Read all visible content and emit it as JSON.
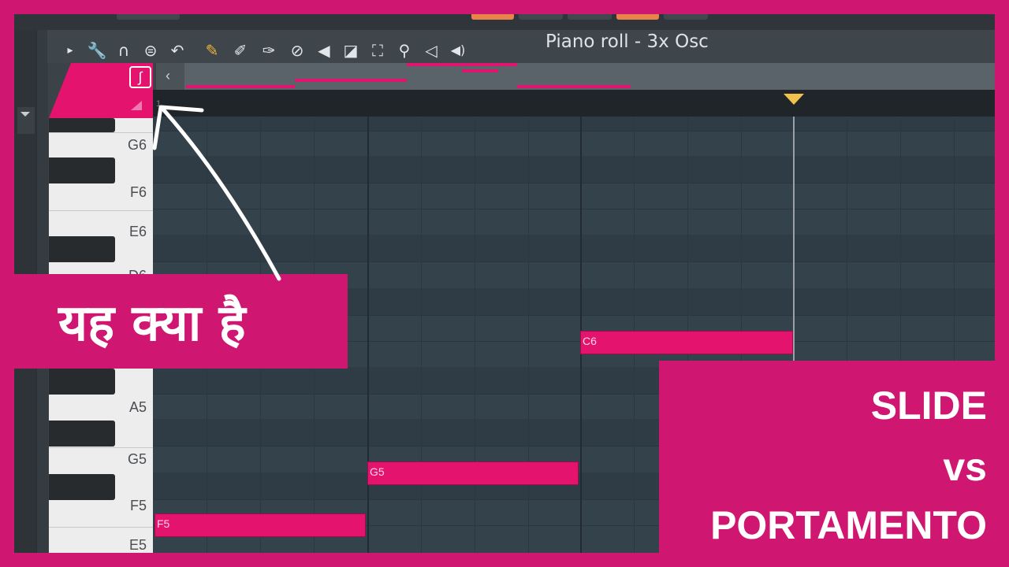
{
  "toolbar": {
    "title": "Piano roll - 3x Osc",
    "icons": [
      "play-arrow-icon",
      "wrench-icon",
      "magnet-icon",
      "menu-circle-icon",
      "undo-icon",
      "pencil-tag-icon",
      "brush-icon",
      "paint-icon",
      "delete-icon",
      "mute-icon",
      "slice-icon",
      "select-icon",
      "zoom-icon",
      "playback-icon",
      "speaker-icon"
    ]
  },
  "ruler": {
    "beat_marker": "1"
  },
  "piano": {
    "labels": [
      "G6",
      "F6",
      "E6",
      "D6",
      "A5",
      "G5",
      "F5",
      "E5"
    ]
  },
  "notes": [
    {
      "label": "F5"
    },
    {
      "label": "G5"
    },
    {
      "label": "C6"
    }
  ],
  "overlay": {
    "question": "यह क्या है",
    "title_lines": [
      "SLIDE",
      "vs",
      "PORTAMENTO"
    ]
  },
  "colors": {
    "brand_pink": "#cf1670",
    "note_pink": "#e3136e",
    "marker_gold": "#f1c24d"
  }
}
